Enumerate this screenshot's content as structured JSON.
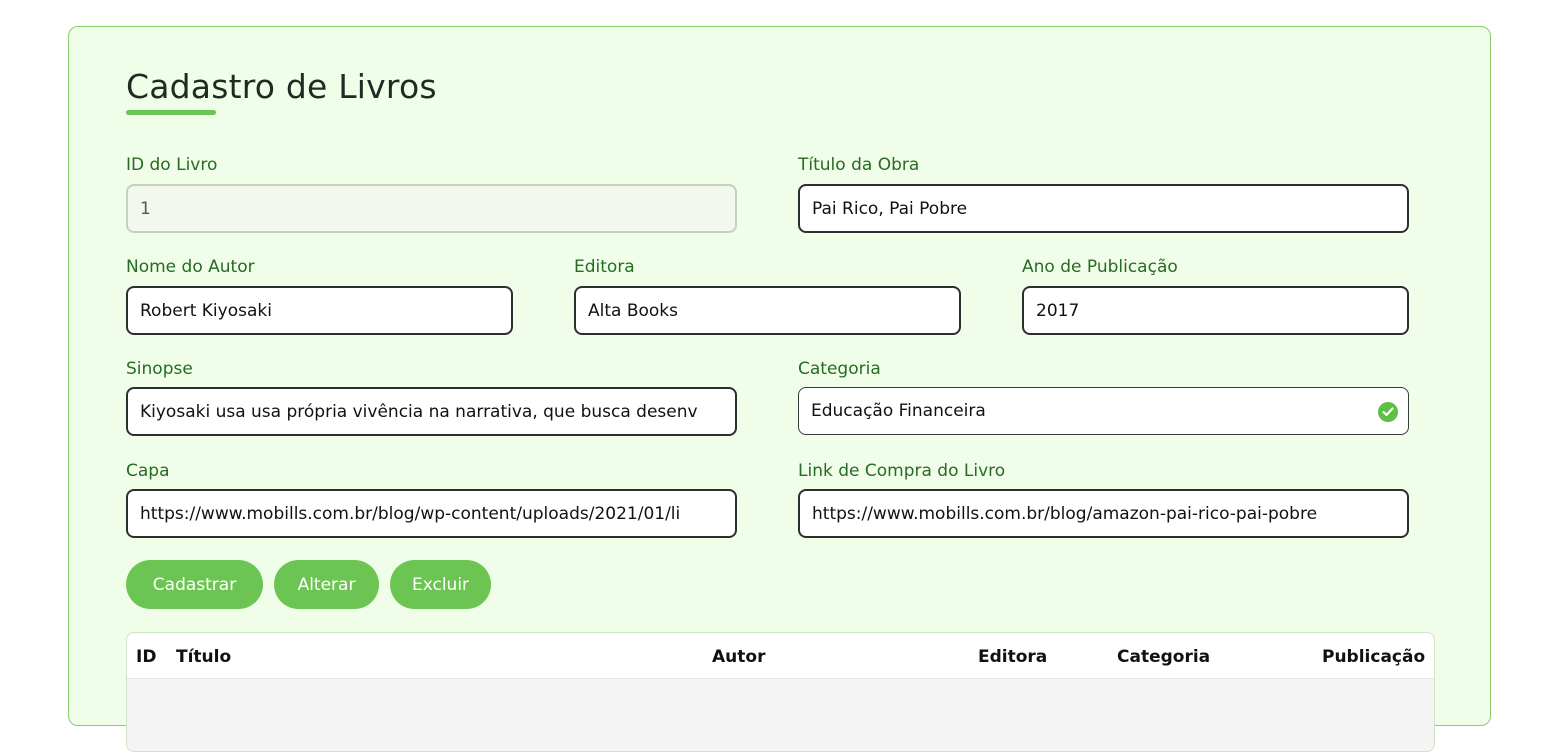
{
  "form": {
    "title": "Cadastro de Livros",
    "id_label": "ID do Livro",
    "id_value": "1",
    "titulo_label": "Título da Obra",
    "titulo_value": "Pai Rico, Pai Pobre",
    "autor_label": "Nome do Autor",
    "autor_value": "Robert Kiyosaki",
    "editora_label": "Editora",
    "editora_value": "Alta Books",
    "ano_label": "Ano de Publicação",
    "ano_value": "2017",
    "sinopse_label": "Sinopse",
    "sinopse_value": "Kiyosaki usa usa própria vivência na narrativa, que busca desenv",
    "categoria_label": "Categoria",
    "categoria_value": "Educação Financeira",
    "capa_label": "Capa",
    "capa_value": "https://www.mobills.com.br/blog/wp-content/uploads/2021/01/li",
    "link_label": "Link de Compra do Livro",
    "link_value": "https://www.mobills.com.br/blog/amazon-pai-rico-pai-pobre"
  },
  "buttons": {
    "cadastrar": "Cadastrar",
    "alterar": "Alterar",
    "excluir": "Excluir"
  },
  "table": {
    "headers": [
      "ID",
      "Título",
      "Autor",
      "Editora",
      "Categoria",
      "Publicação"
    ]
  },
  "icons": {
    "categoria_valid": "check-circle-icon"
  },
  "colors": {
    "accent": "#6cc552",
    "card_bg": "#f0fde9",
    "label": "#276b24"
  }
}
